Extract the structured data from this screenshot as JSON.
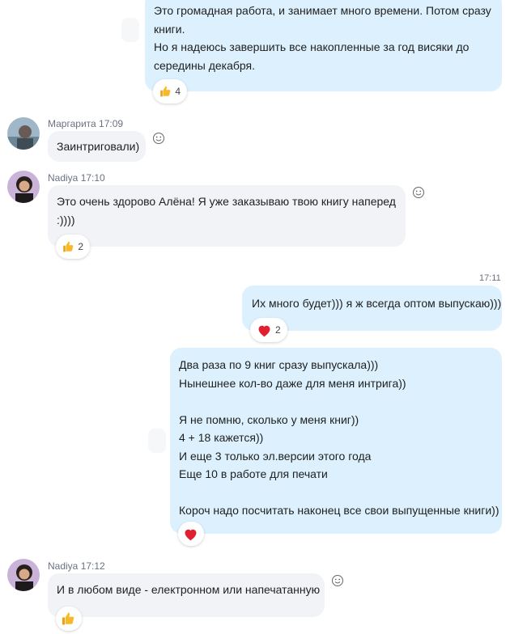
{
  "messages": [
    {
      "lines": "Это громадная работа, и занимает много времени. Потом сразу\nкниги.\nНо я надеюсь завершить все накопленные за год висяки до\nсередины декабря.",
      "reaction": {
        "icon": "thumbs-up-icon",
        "count": "4"
      }
    },
    {
      "sender": "Маргарита",
      "time": "17:09",
      "text": "Заинтриговали)"
    },
    {
      "sender": "Nadiya",
      "time": "17:10",
      "text": " Это очень здорово Алёна! Я уже заказываю твою книгу наперед\n:))))",
      "reaction": {
        "icon": "thumbs-up-icon",
        "count": "2"
      }
    },
    {
      "time": "17:11",
      "text": "Их много будет))) я ж всегда оптом выпускаю)))",
      "reaction": {
        "icon": "heart-icon",
        "count": "2"
      }
    },
    {
      "text": "Два раза по 9 книг сразу выпускала)))\nНынешнее кол-во даже для меня интрига))\n\nЯ не помню, сколько у меня книг))\n4 + 18 кажется))\nИ еще 3 только эл.версии этого года\nЕще 10 в работе для печати\n\nКороч надо посчитать наконец все свои выпущенные книги))",
      "reaction": {
        "icon": "heart-icon"
      }
    },
    {
      "sender": "Nadiya",
      "time": "17:12",
      "text": "И в любом виде - електронном или напечатанную",
      "reaction": {
        "icon": "thumbs-up-icon"
      }
    }
  ],
  "colors": {
    "outgoing_bubble": "#dcf1fd",
    "incoming_bubble": "#f1f3f6",
    "heart": "#e0202e",
    "thumbs": "#f7b928"
  }
}
